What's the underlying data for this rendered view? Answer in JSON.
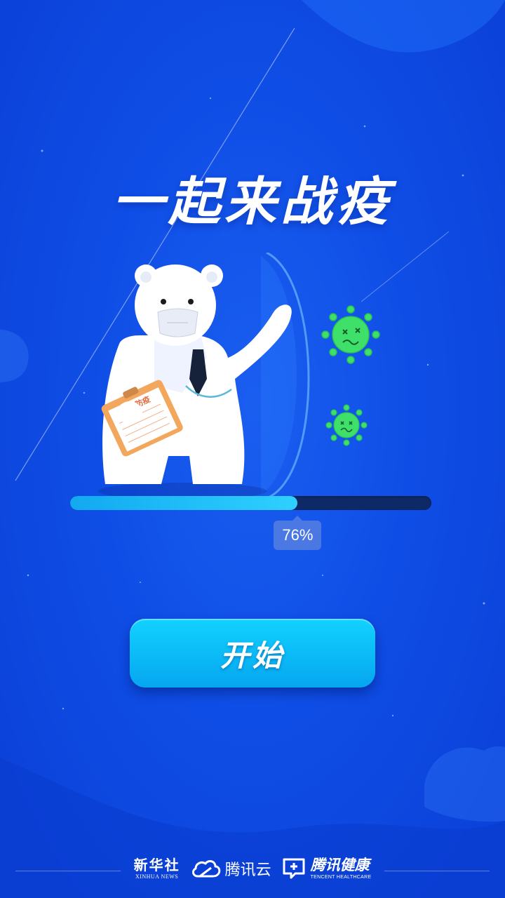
{
  "title": "一起来战疫",
  "progress": {
    "value": 0.63,
    "label": "76%"
  },
  "start_button": {
    "label": "开始"
  },
  "clipboard_text": "科学防疫",
  "footer": {
    "xinhua_cn": "新华社",
    "xinhua_en": "XINHUA NEWS",
    "tencent_cloud": "腾讯云",
    "tencent_health_cn": "腾讯健康",
    "tencent_health_en": "TENCENT HEALTHCARE"
  },
  "colors": {
    "background": "#0f4ee6",
    "button": "#06a6ef",
    "progress_fill": "#2fd0ff",
    "progress_track": "#0e2a66",
    "virus": "#3ee06a"
  },
  "icons": [
    "bear-doctor-illustration",
    "virus-icon",
    "cloud-icon",
    "health-cross-icon"
  ]
}
